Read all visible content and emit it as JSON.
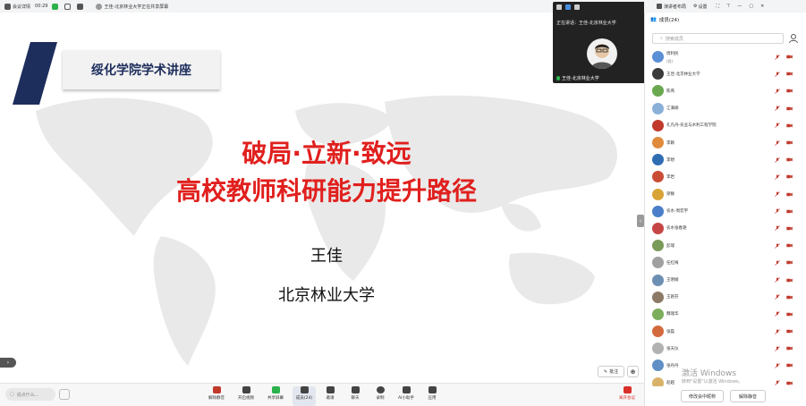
{
  "top_bar": {
    "meeting_details": "会议详情",
    "timer": "00:29",
    "sharing_notice": "王佳-北京林业大学正在共享屏幕"
  },
  "slide": {
    "header": "绥化学院学术讲座",
    "title_line1": "破局·立新·致远",
    "title_line2": "高校教师科研能力提升路径",
    "author": "王佳",
    "institution": "北京林业大学",
    "annotate_label": "批注",
    "colors": {
      "title": "#e0201e",
      "banner": "#1d2d5c"
    }
  },
  "video": {
    "speaking_label": "正在讲话：王佳-北京林业大学",
    "speaker_name": "王佳-北京林业大学"
  },
  "right_top": {
    "layout_label": "演讲者布局",
    "settings_label": "设置"
  },
  "members_panel": {
    "title": "成员(24)",
    "search_placeholder": "搜索成员",
    "members": [
      {
        "name": "周利民",
        "sub": "(我)",
        "avatar_color": "#5b8fd6"
      },
      {
        "name": "王佳-北京林业大学",
        "sub": "",
        "avatar_color": "#3a3a3a"
      },
      {
        "name": "陈燕",
        "sub": "",
        "avatar_color": "#6aa84f"
      },
      {
        "name": "江满娟",
        "sub": "",
        "avatar_color": "#8ab0d8"
      },
      {
        "name": "孔凡丹-农业与水利工程学院",
        "sub": "",
        "avatar_color": "#c0392b"
      },
      {
        "name": "李颖",
        "sub": "",
        "avatar_color": "#e08a3c"
      },
      {
        "name": "李想",
        "sub": "",
        "avatar_color": "#2f6db3"
      },
      {
        "name": "李岩",
        "sub": "",
        "avatar_color": "#c94d36"
      },
      {
        "name": "梁静",
        "sub": "",
        "avatar_color": "#d9a436"
      },
      {
        "name": "农水-周宏宇",
        "sub": "",
        "avatar_color": "#4a7ec9"
      },
      {
        "name": "农水张春艳",
        "sub": "",
        "avatar_color": "#c64545"
      },
      {
        "name": "彭瑞",
        "sub": "",
        "avatar_color": "#7a9a5a"
      },
      {
        "name": "任红梅",
        "sub": "",
        "avatar_color": "#a0a0a0"
      },
      {
        "name": "王明娟",
        "sub": "",
        "avatar_color": "#6d8fb3"
      },
      {
        "name": "王艳芬",
        "sub": "",
        "avatar_color": "#8c7a66"
      },
      {
        "name": "魏瑞华",
        "sub": "",
        "avatar_color": "#7cae5c"
      },
      {
        "name": "张磊",
        "sub": "",
        "avatar_color": "#d26a3e"
      },
      {
        "name": "张天仪",
        "sub": "",
        "avatar_color": "#b2b2b2"
      },
      {
        "name": "张丹丹",
        "sub": "",
        "avatar_color": "#5f8fc4"
      },
      {
        "name": "赵越",
        "sub": "",
        "avatar_color": "#d9b26a"
      }
    ],
    "footer_buttons": [
      "修改会中昵称",
      "解除静音"
    ]
  },
  "toolbar": {
    "chat_placeholder": "说点什么...",
    "items": [
      {
        "label": "解除静音",
        "icon": "mic-off-icon"
      },
      {
        "label": "开启视频",
        "icon": "camera-off-icon"
      },
      {
        "label": "共享屏幕",
        "icon": "screen-share-icon"
      },
      {
        "label": "成员(24)",
        "icon": "members-icon"
      },
      {
        "label": "邀请",
        "icon": "invite-icon"
      },
      {
        "label": "聊天",
        "icon": "chat-icon"
      },
      {
        "label": "录制",
        "icon": "record-icon"
      },
      {
        "label": "AI小助手",
        "icon": "ai-assistant-icon"
      },
      {
        "label": "应用",
        "icon": "apps-icon"
      }
    ],
    "leave_label": "离开会议"
  },
  "watermark": {
    "line1": "激活 Windows",
    "line2": "转到\"设置\"以激活 Windows。"
  }
}
